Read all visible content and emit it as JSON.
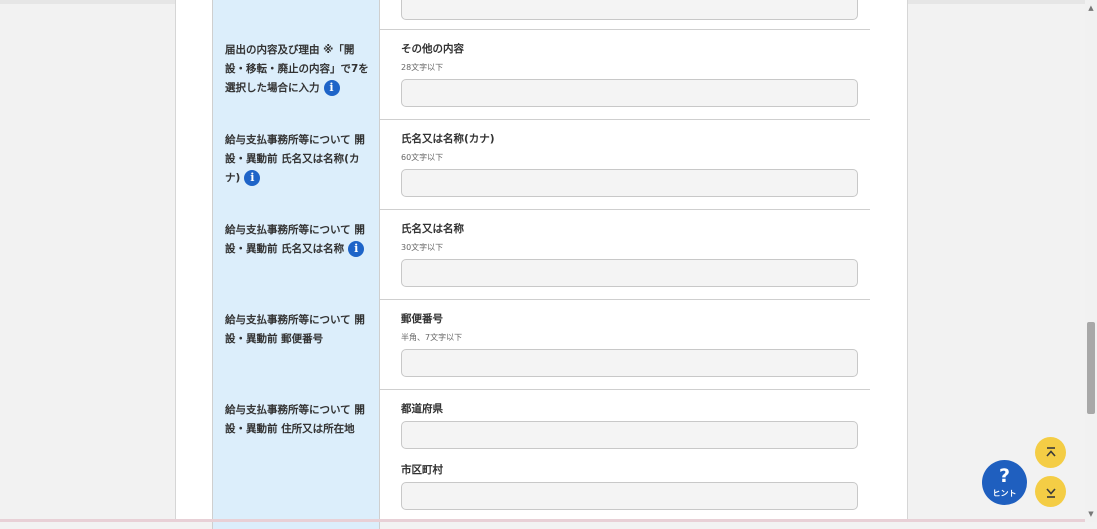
{
  "rows": [
    {
      "label": "",
      "fields": []
    },
    {
      "label": "届出の内容及び理由 ※「開設・移転・廃止の内容」で7を選択した場合に入力",
      "fields": [
        {
          "name": "その他の内容",
          "hint": "28文字以下",
          "value": ""
        }
      ]
    },
    {
      "label": "給与支払事務所等について 開設・異動前 氏名又は名称(カナ)",
      "fields": [
        {
          "name": "氏名又は名称(カナ)",
          "hint": "60文字以下",
          "value": ""
        }
      ]
    },
    {
      "label": "給与支払事務所等について 開設・異動前 氏名又は名称",
      "fields": [
        {
          "name": "氏名又は名称",
          "hint": "30文字以下",
          "value": ""
        }
      ]
    },
    {
      "label": "給与支払事務所等について 開設・異動前 郵便番号",
      "fields": [
        {
          "name": "郵便番号",
          "hint": "半角、7文字以下",
          "value": ""
        }
      ]
    },
    {
      "label": "給与支払事務所等について 開設・異動前 住所又は所在地",
      "fields": [
        {
          "name": "都道府県",
          "hint": "",
          "value": ""
        },
        {
          "name": "市区町村",
          "hint": "",
          "value": ""
        }
      ]
    }
  ],
  "icons": {
    "info": "info-icon",
    "scroll_top": "chevron-up-to-top-icon",
    "scroll_bottom": "chevron-down-to-bottom-icon"
  },
  "info_glyph": "i",
  "hint_button": {
    "glyph": "?",
    "label": "ヒント"
  },
  "colors": {
    "label_bg": "#dceefb",
    "info_blue": "#1e64c8",
    "hint_blue": "#1f5fbf",
    "scroll_btn_yellow": "#f4cd45"
  }
}
